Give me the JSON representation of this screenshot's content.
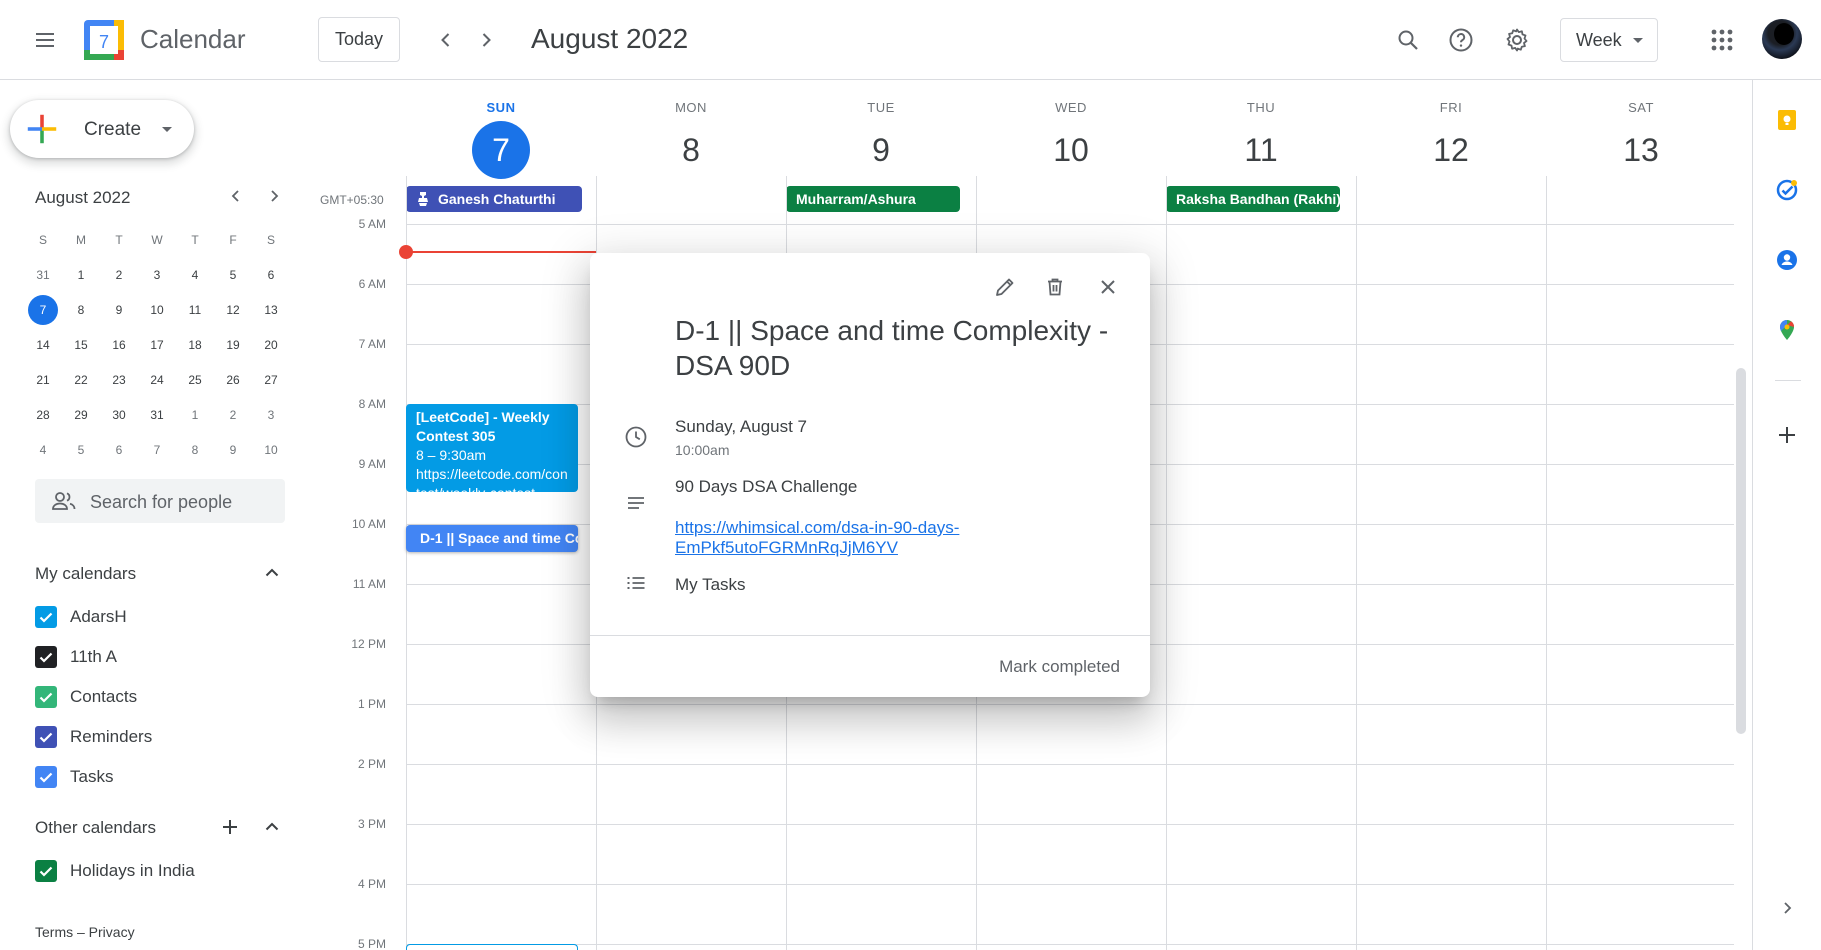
{
  "header": {
    "app_name": "Calendar",
    "logo_day": "7",
    "today_label": "Today",
    "period": "August 2022",
    "view": "Week"
  },
  "sidebar": {
    "create_label": "Create",
    "mini_title": "August 2022",
    "mini_dow": [
      "S",
      "M",
      "T",
      "W",
      "T",
      "F",
      "S"
    ],
    "mini_weeks": [
      [
        "31",
        "1",
        "2",
        "3",
        "4",
        "5",
        "6"
      ],
      [
        "7",
        "8",
        "9",
        "10",
        "11",
        "12",
        "13"
      ],
      [
        "14",
        "15",
        "16",
        "17",
        "18",
        "19",
        "20"
      ],
      [
        "21",
        "22",
        "23",
        "24",
        "25",
        "26",
        "27"
      ],
      [
        "28",
        "29",
        "30",
        "31",
        "1",
        "2",
        "3"
      ],
      [
        "4",
        "5",
        "6",
        "7",
        "8",
        "9",
        "10"
      ]
    ],
    "search_people": "Search for people",
    "my_calendars_title": "My calendars",
    "my_calendars": [
      {
        "label": "AdarsH",
        "color": "#039be5"
      },
      {
        "label": "11th A",
        "color": "#202124"
      },
      {
        "label": "Contacts",
        "color": "#33b679"
      },
      {
        "label": "Reminders",
        "color": "#3f51b5"
      },
      {
        "label": "Tasks",
        "color": "#4285f4"
      }
    ],
    "other_calendars_title": "Other calendars",
    "other_calendars": [
      {
        "label": "Holidays in India",
        "color": "#0b8043"
      }
    ],
    "footer": "Terms – Privacy"
  },
  "week": {
    "timezone": "GMT+05:30",
    "days": [
      {
        "dow": "SUN",
        "num": "7"
      },
      {
        "dow": "MON",
        "num": "8"
      },
      {
        "dow": "TUE",
        "num": "9"
      },
      {
        "dow": "WED",
        "num": "10"
      },
      {
        "dow": "THU",
        "num": "11"
      },
      {
        "dow": "FRI",
        "num": "12"
      },
      {
        "dow": "SAT",
        "num": "13"
      }
    ],
    "hours": [
      "5 AM",
      "6 AM",
      "7 AM",
      "8 AM",
      "9 AM",
      "10 AM",
      "11 AM",
      "12 PM",
      "1 PM",
      "2 PM",
      "3 PM",
      "4 PM",
      "5 PM"
    ],
    "all_day_events": [
      {
        "title": "Ganesh Chaturthi",
        "color": "#3f51b5"
      },
      {
        "title": "Muharram/Ashura",
        "color": "#0b8043"
      },
      {
        "title": "Raksha Bandhan (Rakhi)",
        "color": "#0b8043"
      }
    ],
    "events": [
      {
        "title": "[LeetCode] - Weekly Contest 305",
        "time": "8 – 9:30am",
        "location": "https://leetcode.com/contest/weekly-contest",
        "color": "#039be5"
      },
      {
        "title": "D-1 || Space and time Complexity - DSA 90D",
        "color": "#4285f4"
      }
    ]
  },
  "popover": {
    "title": "D-1 || Space and time Complexity - DSA 90D",
    "date": "Sunday, August 7",
    "time": "10:00am",
    "description": "90 Days DSA Challenge",
    "link": "https://whimsical.com/dsa-in-90-days-EmPkf5utoFGRMnRqJjM6YV",
    "list": "My Tasks",
    "mark_completed": "Mark completed"
  }
}
